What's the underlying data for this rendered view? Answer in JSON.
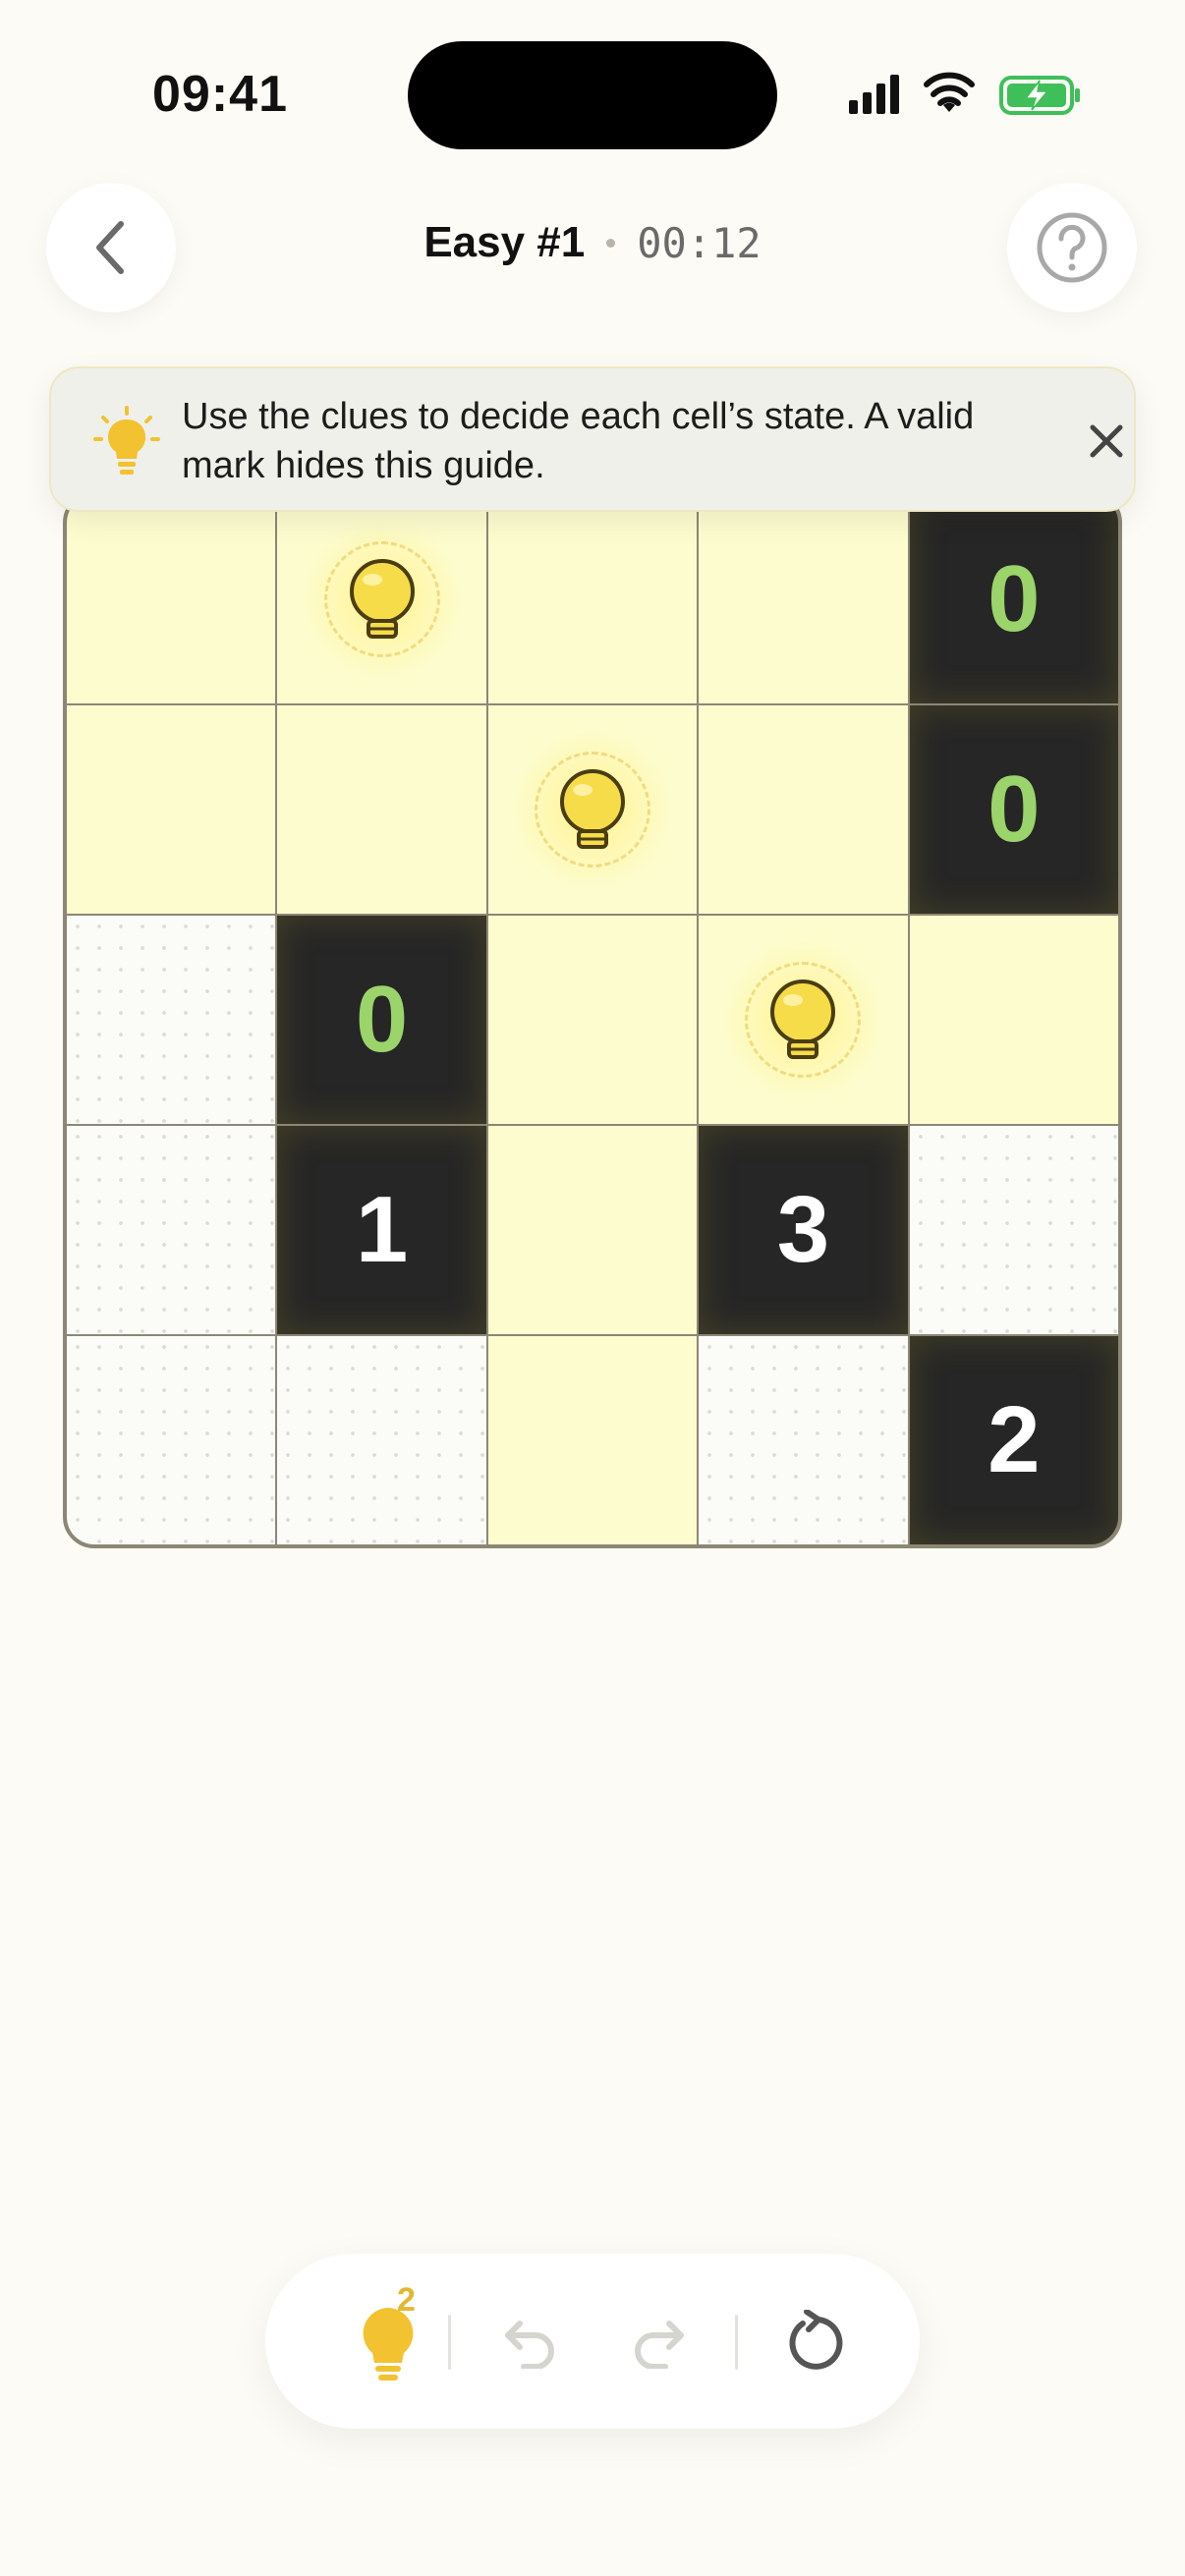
{
  "status_bar": {
    "time": "09:41"
  },
  "header": {
    "title": "Easy #1",
    "timer": "00:12"
  },
  "banner": {
    "text": "Use the clues to decide each cell’s state. A valid mark hides this guide."
  },
  "board": {
    "rows": 5,
    "cols": 5,
    "cells": [
      [
        {
          "type": "lit"
        },
        {
          "type": "bulb"
        },
        {
          "type": "lit"
        },
        {
          "type": "lit"
        },
        {
          "type": "wall",
          "number": "0",
          "satisfied": true
        }
      ],
      [
        {
          "type": "lit"
        },
        {
          "type": "lit"
        },
        {
          "type": "bulb"
        },
        {
          "type": "lit"
        },
        {
          "type": "wall",
          "number": "0",
          "satisfied": true
        }
      ],
      [
        {
          "type": "unlit"
        },
        {
          "type": "wall",
          "number": "0",
          "satisfied": true
        },
        {
          "type": "lit"
        },
        {
          "type": "bulb"
        },
        {
          "type": "lit"
        }
      ],
      [
        {
          "type": "unlit"
        },
        {
          "type": "wall",
          "number": "1",
          "satisfied": false
        },
        {
          "type": "lit"
        },
        {
          "type": "wall",
          "number": "3",
          "satisfied": false
        },
        {
          "type": "unlit"
        }
      ],
      [
        {
          "type": "unlit"
        },
        {
          "type": "unlit"
        },
        {
          "type": "lit"
        },
        {
          "type": "unlit"
        },
        {
          "type": "wall",
          "number": "2",
          "satisfied": false
        }
      ]
    ]
  },
  "toolbar": {
    "hint_count": "2"
  },
  "colors": {
    "background": "#fdfbf5",
    "lit_cell": "#fdfccf",
    "wall": "#262626",
    "satisfied_number": "#9ad46a",
    "bulb": "#f7dc4a",
    "accent_yellow": "#e2b830"
  },
  "icons": [
    "back-chevron-icon",
    "help-icon",
    "lightbulb-icon",
    "close-icon",
    "undo-icon",
    "redo-icon",
    "reset-icon"
  ]
}
